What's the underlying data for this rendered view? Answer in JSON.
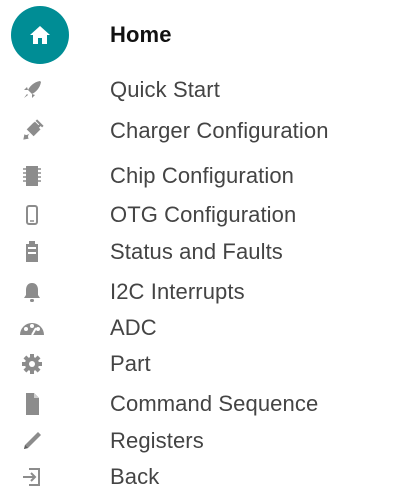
{
  "nav": {
    "items": [
      {
        "label": "Home",
        "icon": "home-icon",
        "active": true
      },
      {
        "label": "Quick Start",
        "icon": "rocket-icon"
      },
      {
        "label": "Charger Configuration",
        "icon": "plug-icon"
      },
      {
        "label": "Chip Configuration",
        "icon": "chip-icon"
      },
      {
        "label": "OTG Configuration",
        "icon": "phone-icon"
      },
      {
        "label": "Status and Faults",
        "icon": "battery-icon"
      },
      {
        "label": "I2C Interrupts",
        "icon": "bell-icon"
      },
      {
        "label": "ADC",
        "icon": "gauge-icon"
      },
      {
        "label": "Part",
        "icon": "gear-icon"
      },
      {
        "label": "Command Sequence",
        "icon": "file-icon"
      },
      {
        "label": "Registers",
        "icon": "pencil-icon"
      },
      {
        "label": "Back",
        "icon": "exit-icon"
      }
    ]
  },
  "colors": {
    "accent": "#008d95",
    "icon_gray": "#8c8c8c",
    "text": "#444444"
  }
}
